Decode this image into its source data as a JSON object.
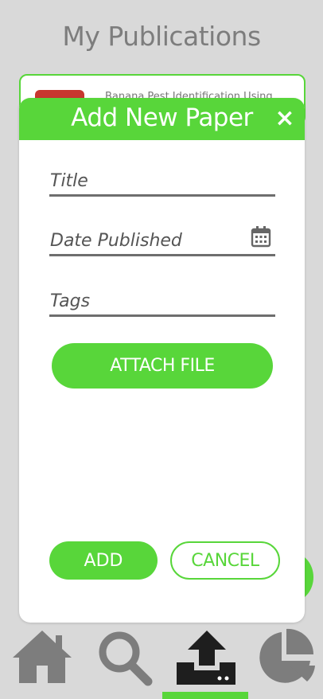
{
  "page": {
    "title": "My Publications"
  },
  "background_list": {
    "first_item_text": "Banana Pest Identification Using"
  },
  "modal": {
    "title": "Add New Paper",
    "close_label": "×",
    "fields": {
      "title_placeholder": "Title",
      "date_placeholder": "Date Published",
      "tags_placeholder": "Tags"
    },
    "attach_label": "ATTACH FILE",
    "add_label": "ADD",
    "cancel_label": "CANCEL"
  },
  "nav": {
    "active": "upload",
    "items": [
      "home-icon",
      "search-icon",
      "upload-icon",
      "pie-chart-icon"
    ]
  },
  "colors": {
    "accent": "#58d63a",
    "background": "#d9d9d9",
    "nav_icon": "#7d7d7d",
    "nav_icon_active": "#1e1e1e"
  }
}
